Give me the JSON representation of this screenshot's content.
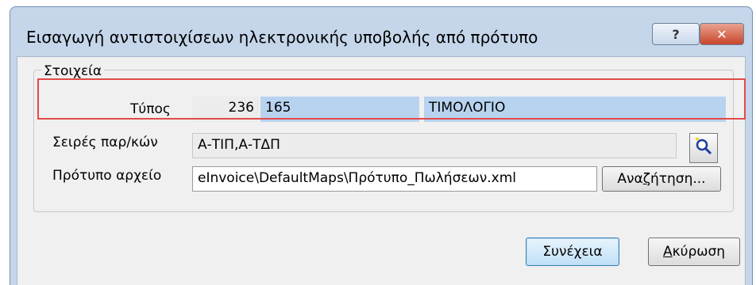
{
  "window": {
    "title": "Εισαγωγή αντιστοιχίσεων ηλεκτρονικής υποβολής από πρότυπο",
    "help_label": "?",
    "close_label": "✕"
  },
  "group": {
    "label": "Στοιχεία"
  },
  "type_row": {
    "label": "Τύπος",
    "code": "236",
    "id": "165",
    "name": "ΤΙΜΟΛΟΓΙΟ"
  },
  "series_row": {
    "label": "Σειρές παρ/κών",
    "value": "Α-ΤΙΠ,Α-ΤΔΠ",
    "lookup_icon": "search-key-icon"
  },
  "template_row": {
    "label": "Πρότυπο αρχείο",
    "value": "eInvoice\\DefaultMaps\\Πρότυπο_Πωλήσεων.xml",
    "browse_pre": "Ανα",
    "browse_u": "ζ",
    "browse_post": "ήτηση..."
  },
  "buttons": {
    "continue_label": "Συνέχεια",
    "cancel_u": "Α",
    "cancel_rest": "κύρωση"
  },
  "colors": {
    "highlight_border": "#e14a4a",
    "field_blue": "#b8d3ef"
  }
}
